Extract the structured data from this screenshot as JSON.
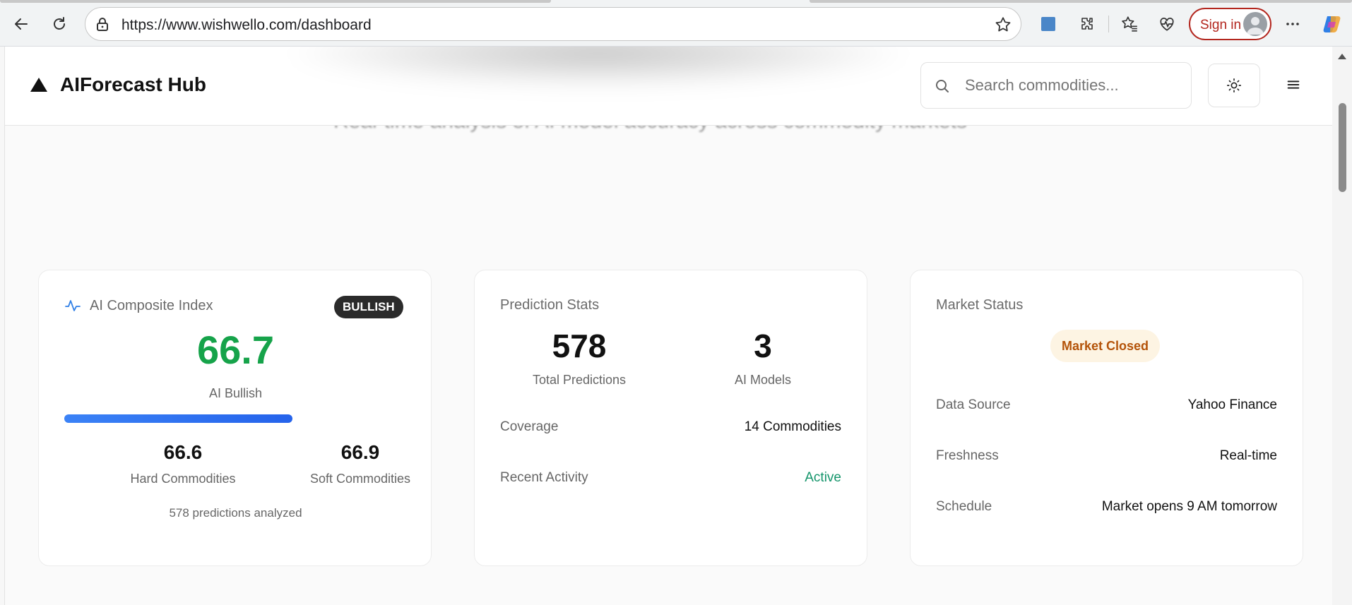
{
  "browser": {
    "url": "https://www.wishwello.com/dashboard",
    "sign_in_label": "Sign in"
  },
  "header": {
    "brand": "AIForecast Hub",
    "search_placeholder": "Search commodities..."
  },
  "hero": {
    "subtitle": "Real-time analysis of AI model accuracy across commodity markets"
  },
  "composite": {
    "title": "AI Composite Index",
    "badge": "BULLISH",
    "value": "66.7",
    "sentiment": "AI Bullish",
    "progress_percent": 66.7,
    "hard_value": "66.6",
    "hard_label": "Hard Commodities",
    "soft_value": "66.9",
    "soft_label": "Soft Commodities",
    "footer": "578 predictions analyzed",
    "value_color": "#16a34a"
  },
  "prediction_stats": {
    "title": "Prediction Stats",
    "total_value": "578",
    "total_label": "Total Predictions",
    "models_value": "3",
    "models_label": "AI Models",
    "coverage_label": "Coverage",
    "coverage_value": "14 Commodities",
    "activity_label": "Recent Activity",
    "activity_value": "Active"
  },
  "market_status": {
    "title": "Market Status",
    "status": "Market Closed",
    "data_source_label": "Data Source",
    "data_source_value": "Yahoo Finance",
    "freshness_label": "Freshness",
    "freshness_value": "Real-time",
    "schedule_label": "Schedule",
    "schedule_value": "Market opens 9 AM tomorrow"
  },
  "icons": [
    "back-icon",
    "refresh-icon",
    "lock-icon",
    "star-icon",
    "extension-icon",
    "puzzle-icon",
    "favorites-icon",
    "health-icon",
    "more-icon",
    "copilot-icon",
    "search-icon",
    "sun-icon",
    "menu-icon",
    "activity-icon"
  ]
}
